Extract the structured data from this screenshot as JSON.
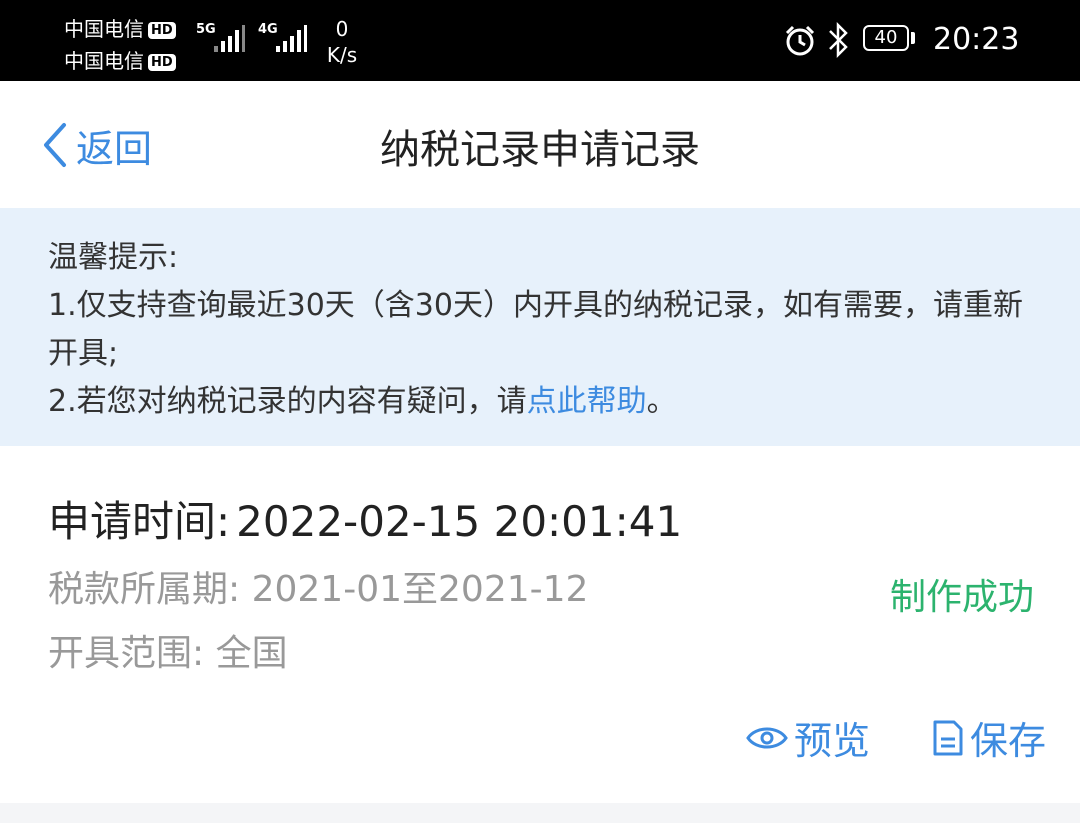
{
  "status_bar": {
    "carrier1": "中国电信",
    "carrier2": "中国电信",
    "hd": "HD",
    "net1": "5G",
    "net2": "4G",
    "speed_value": "0",
    "speed_unit": "K/s",
    "battery": "40",
    "time": "20:23"
  },
  "nav": {
    "back_label": "返回",
    "title": "纳税记录申请记录"
  },
  "notice": {
    "heading": "温馨提示:",
    "line1": "1.仅支持查询最近30天（含30天）内开具的纳税记录，如有需要，请重新开具;",
    "line2_prefix": "2.若您对纳税记录的内容有疑问，请",
    "line2_link": "点此帮助",
    "line2_suffix": "。"
  },
  "record": {
    "apply_time_label": "申请时间:",
    "apply_time_value": "2022-02-15 20:01:41",
    "period_label": "税款所属期:",
    "period_value": "2021-01至2021-12",
    "scope_label": "开具范围:",
    "scope_value": "全国",
    "status": "制作成功",
    "status_color": "#2cb36e",
    "preview_label": "预览",
    "save_label": "保存"
  },
  "colors": {
    "accent": "#3d8be0",
    "notice_bg": "#e7f1fb"
  }
}
